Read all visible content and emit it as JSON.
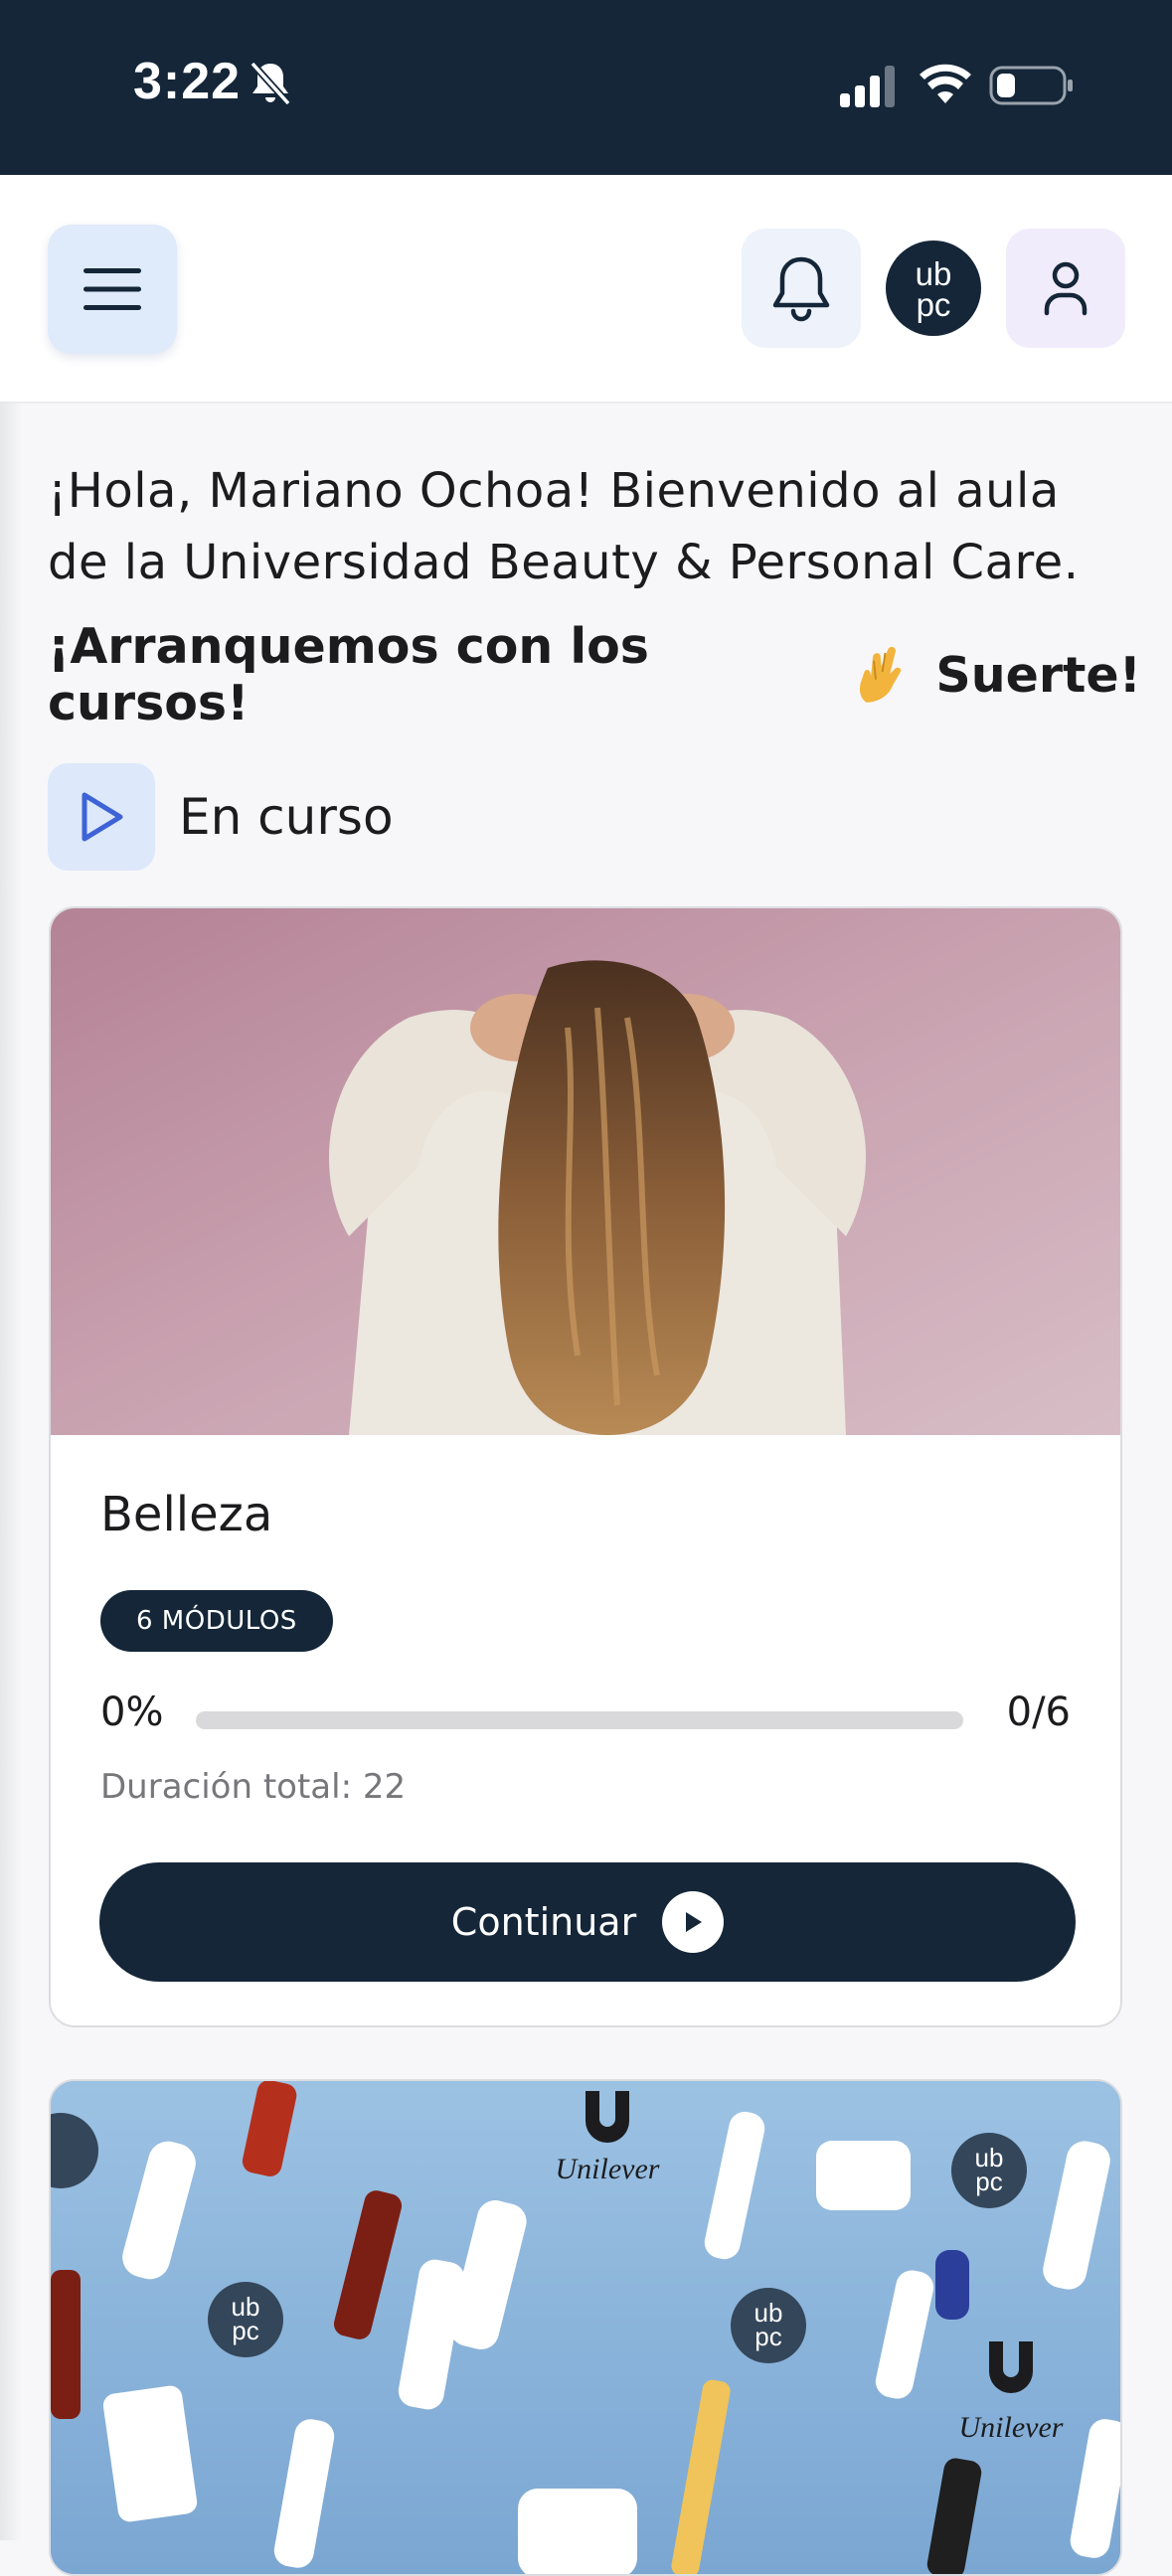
{
  "status_bar": {
    "time": "3:22"
  },
  "header": {
    "menu_icon": "hamburger-icon",
    "notifications_icon": "bell-icon",
    "logo_text": "ub pc",
    "profile_icon": "user-icon"
  },
  "welcome": {
    "greeting": "¡Hola, Mariano Ochoa! Bienvenido al aula de la Universidad Beauty & Personal Care.",
    "cta_left": "¡Arranquemos con los cursos!",
    "cta_emoji": "crossed-fingers",
    "cta_right": "Suerte!"
  },
  "section": {
    "icon": "play-icon",
    "title": "En curso"
  },
  "courses": [
    {
      "title": "Belleza",
      "modules_badge": "6 MÓDULOS",
      "progress_percent_label": "0%",
      "progress_fraction": 0,
      "progress_count": "0/6",
      "duration": "Duración total: 22",
      "button_label": "Continuar"
    },
    {
      "image_logo_text": "Unilever"
    }
  ],
  "colors": {
    "navy": "#142638",
    "menu_bg": "#dfeafb",
    "profile_bg": "#f1ecfb",
    "track": "#d9d9db"
  }
}
